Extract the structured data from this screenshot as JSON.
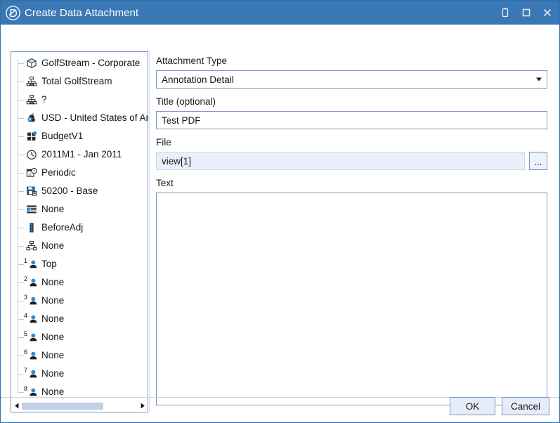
{
  "window": {
    "title": "Create Data Attachment",
    "logo_icon": "dynamic-d-logo-icon",
    "controls": [
      {
        "name": "restore-icon",
        "glyph": "restore"
      },
      {
        "name": "maximize-icon",
        "glyph": "maximize"
      },
      {
        "name": "close-icon",
        "glyph": "close"
      }
    ],
    "colors": {
      "titlebar_bg": "#3a78b5",
      "titlebar_text": "#ffffff",
      "border": "#2f6fad",
      "field_border": "#7b96c4",
      "file_field_bg": "#eaeffa",
      "button_bg": "#e6edf9",
      "scrollbar_thumb": "#c3d0e8",
      "icon_accent": "#2a8ad4"
    }
  },
  "tree": {
    "items": [
      {
        "label": "GolfStream - Corporate",
        "icon": "cube-icon"
      },
      {
        "label": "Total GolfStream",
        "icon": "hierarchy-icon"
      },
      {
        "label": "?",
        "icon": "hierarchy-icon"
      },
      {
        "label": "USD - United States of Ame",
        "icon": "currency-icon"
      },
      {
        "label": "BudgetV1",
        "icon": "scenario-blocks-icon"
      },
      {
        "label": "2011M1 - Jan 2011",
        "icon": "clock-icon"
      },
      {
        "label": "Periodic",
        "icon": "calendar-clock-icon"
      },
      {
        "label": "50200 - Base",
        "icon": "account-icon"
      },
      {
        "label": "None",
        "icon": "list-detail-icon"
      },
      {
        "label": "BeforeAdj",
        "icon": "film-strip-icon"
      },
      {
        "label": "None",
        "icon": "hierarchy-flow-icon"
      },
      {
        "label": "Top",
        "icon": "user-1-icon",
        "number": "1"
      },
      {
        "label": "None",
        "icon": "user-2-icon",
        "number": "2"
      },
      {
        "label": "None",
        "icon": "user-3-icon",
        "number": "3"
      },
      {
        "label": "None",
        "icon": "user-4-icon",
        "number": "4"
      },
      {
        "label": "None",
        "icon": "user-5-icon",
        "number": "5"
      },
      {
        "label": "None",
        "icon": "user-6-icon",
        "number": "6"
      },
      {
        "label": "None",
        "icon": "user-7-icon",
        "number": "7"
      },
      {
        "label": "None",
        "icon": "user-8-icon",
        "number": "8"
      }
    ],
    "scrollbar": {
      "left_arrow": "scroll-left-icon",
      "right_arrow": "scroll-right-icon",
      "thumb_fraction": "71%"
    }
  },
  "form": {
    "attachment_type": {
      "label": "Attachment Type",
      "value": "Annotation Detail"
    },
    "title": {
      "label": "Title (optional)",
      "value": "Test PDF",
      "placeholder": ""
    },
    "file": {
      "label": "File",
      "value": "view[1]",
      "browse_label": "..."
    },
    "text": {
      "label": "Text",
      "value": "",
      "placeholder": ""
    }
  },
  "footer": {
    "ok_label": "OK",
    "cancel_label": "Cancel"
  }
}
